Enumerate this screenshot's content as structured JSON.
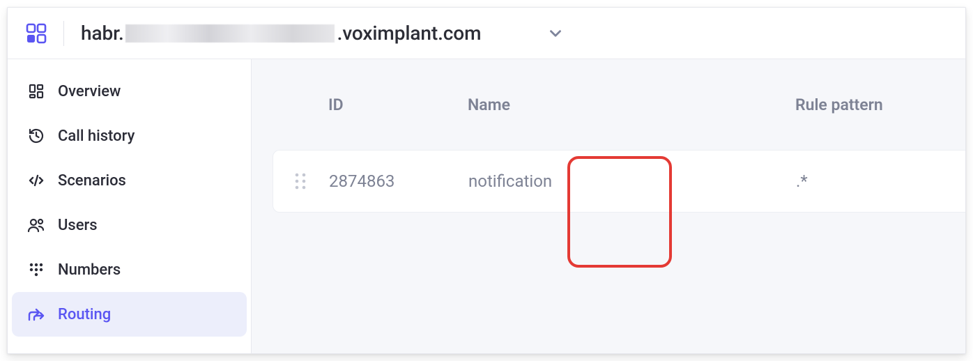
{
  "header": {
    "domain_prefix": "habr.",
    "domain_suffix": ".voximplant.com"
  },
  "sidebar": {
    "items": [
      {
        "label": "Overview"
      },
      {
        "label": "Call history"
      },
      {
        "label": "Scenarios"
      },
      {
        "label": "Users"
      },
      {
        "label": "Numbers"
      },
      {
        "label": "Routing"
      }
    ],
    "active_index": 5
  },
  "table": {
    "columns": {
      "id": "ID",
      "name": "Name",
      "pattern": "Rule pattern"
    },
    "rows": [
      {
        "id": "2874863",
        "name": "notification",
        "pattern": ".*"
      }
    ]
  }
}
